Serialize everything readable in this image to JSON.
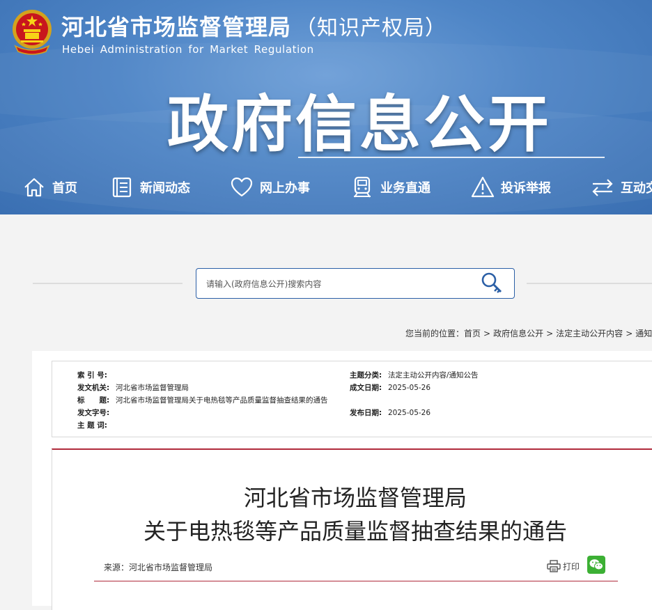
{
  "site": {
    "name_cn": "河北省市场监督管理局",
    "name_cn_suffix": "（知识产权局）",
    "name_en": "Hebei Administration for Market Regulation",
    "banner": "政府信息公开"
  },
  "nav": {
    "items": [
      {
        "label": "首页",
        "icon": "home-icon"
      },
      {
        "label": "新闻动态",
        "icon": "news-icon"
      },
      {
        "label": "网上办事",
        "icon": "heart-icon"
      },
      {
        "label": "业务直通",
        "icon": "train-icon"
      },
      {
        "label": "投诉举报",
        "icon": "warning-icon"
      },
      {
        "label": "互动交流",
        "icon": "exchange-icon"
      }
    ]
  },
  "search": {
    "placeholder": "请输入(政府信息公开)搜索内容"
  },
  "breadcrumb": {
    "prefix": "您当前的位置：",
    "items": [
      "首页",
      "政府信息公开",
      "法定主动公开内容",
      "通知公告"
    ]
  },
  "meta": {
    "index_label": "索 引 号:",
    "index_value": "",
    "issuer_label": "发文机关:",
    "issuer_value": "河北省市场监督管理局",
    "title_label": "标　　题:",
    "title_value": "河北省市场监督管理局关于电热毯等产品质量监督抽查结果的通告",
    "doc_no_label": "发文字号:",
    "doc_no_value": "",
    "keywords_label": "主 题 词:",
    "keywords_value": "",
    "category_label": "主题分类:",
    "category_value": "法定主动公开内容/通知公告",
    "created_label": "成文日期:",
    "created_value": "2025-05-26",
    "published_label": "发布日期:",
    "published_value": "2025-05-26"
  },
  "article": {
    "title_line1": "河北省市场监督管理局",
    "title_line2": "关于电热毯等产品质量监督抽查结果的通告",
    "source": "来源：河北省市场监督管理局",
    "print_label": "打印"
  },
  "colors": {
    "header_blue": "#4e85c6",
    "accent_red": "#b02a3b",
    "search_border": "#2b5fa6"
  }
}
